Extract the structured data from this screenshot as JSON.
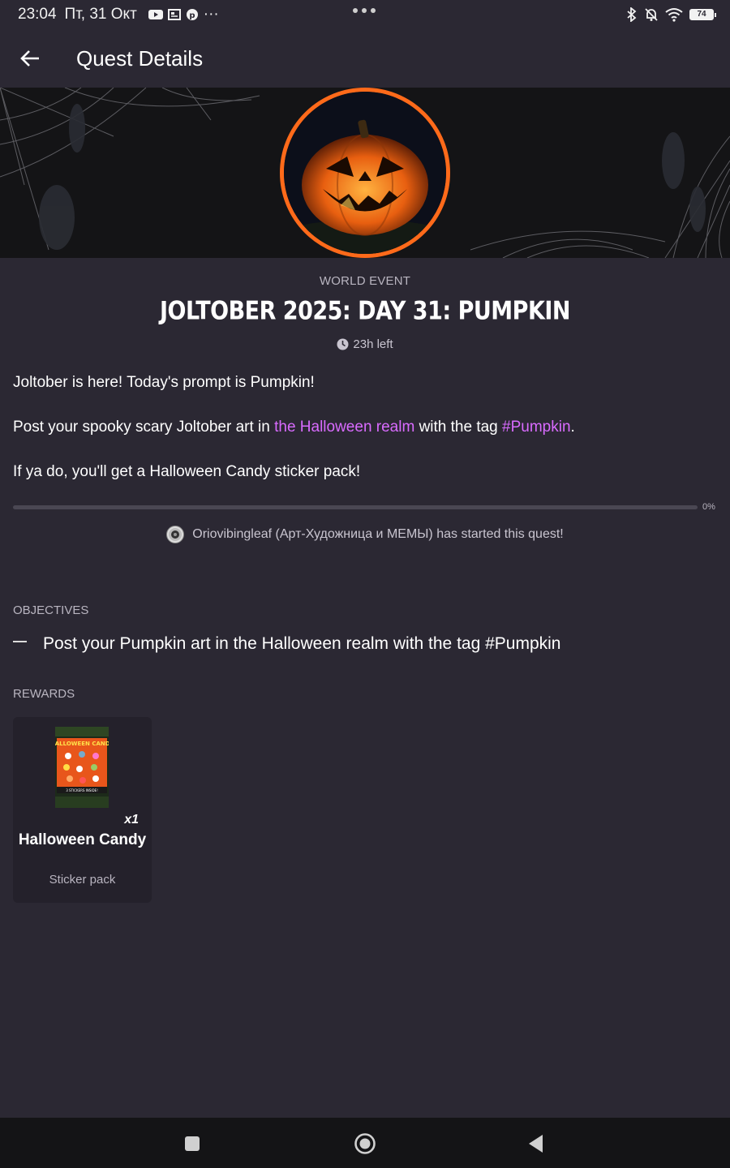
{
  "status_bar": {
    "time": "23:04",
    "date": "Пт, 31 Окт",
    "notification_icons": [
      "youtube-icon",
      "news-icon",
      "pinterest-icon"
    ],
    "more_notifications": "···",
    "battery": "74"
  },
  "header": {
    "title": "Quest Details"
  },
  "quest": {
    "event_type": "WORLD EVENT",
    "title": "JOLTOBER 2025: DAY 31: PUMPKIN",
    "time_left": "23h left",
    "desc_line1": "Joltober is here! Today's prompt is Pumpkin!",
    "desc_line2_pre": "Post your spooky scary Joltober art in ",
    "desc_line2_link1": "the Halloween realm",
    "desc_line2_mid": " with the tag ",
    "desc_line2_link2": "#Pumpkin",
    "desc_line2_post": ".",
    "desc_line3": "If ya do, you'll get a Halloween Candy sticker pack!",
    "progress": 0,
    "progress_label": "0%",
    "started_by": "Oriovibingleaf (Арт-Художница и MEMЫ) has started this quest!"
  },
  "objectives": {
    "label": "OBJECTIVES",
    "items": [
      "Post your Pumpkin art in the Halloween realm with the tag #Pumpkin"
    ]
  },
  "rewards": {
    "label": "REWARDS",
    "items": [
      {
        "quantity": "x1",
        "name": "Halloween Candy",
        "type": "Sticker pack",
        "image_text": "HALLOWEEN CANDY",
        "image_footer": "3 STICKERS INSIDE!"
      }
    ]
  },
  "colors": {
    "background": "#2b2833",
    "accent_link": "#d96bff",
    "banner_ring": "#ff6a1a",
    "nav_bar": "#141416"
  }
}
